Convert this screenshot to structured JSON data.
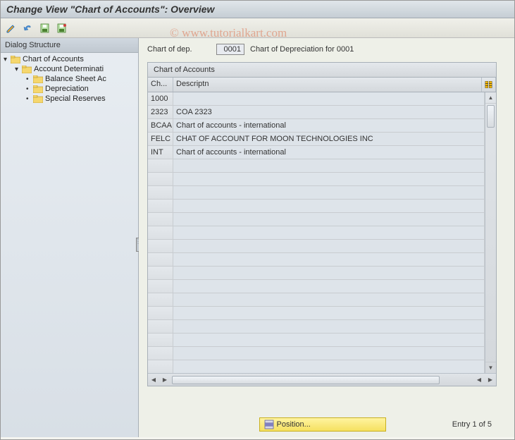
{
  "title": "Change View \"Chart of Accounts\": Overview",
  "watermark": "© www.tutorialkart.com",
  "sidebar": {
    "header": "Dialog Structure",
    "items": [
      {
        "label": "Chart of Accounts",
        "level": 0,
        "open": true
      },
      {
        "label": "Account Determinati",
        "level": 1,
        "open": true
      },
      {
        "label": "Balance Sheet Ac",
        "level": 2,
        "open": false
      },
      {
        "label": "Depreciation",
        "level": 2,
        "open": false
      },
      {
        "label": "Special Reserves",
        "level": 2,
        "open": false
      }
    ]
  },
  "field": {
    "label": "Chart of dep.",
    "value": "0001",
    "description": "Chart of Depreciation for 0001"
  },
  "table": {
    "title": "Chart of Accounts",
    "columns": {
      "code": "Ch...",
      "desc": "Descriptn"
    },
    "rows": [
      {
        "code": "1000",
        "desc": ""
      },
      {
        "code": "2323",
        "desc": "COA 2323"
      },
      {
        "code": "BCAA",
        "desc": "Chart of accounts - international"
      },
      {
        "code": "FELC",
        "desc": "CHAT OF ACCOUNT FOR MOON TECHNOLOGIES INC"
      },
      {
        "code": "INT",
        "desc": "Chart of accounts - international"
      },
      {
        "code": "",
        "desc": ""
      },
      {
        "code": "",
        "desc": ""
      },
      {
        "code": "",
        "desc": ""
      },
      {
        "code": "",
        "desc": ""
      },
      {
        "code": "",
        "desc": ""
      },
      {
        "code": "",
        "desc": ""
      },
      {
        "code": "",
        "desc": ""
      },
      {
        "code": "",
        "desc": ""
      },
      {
        "code": "",
        "desc": ""
      },
      {
        "code": "",
        "desc": ""
      },
      {
        "code": "",
        "desc": ""
      },
      {
        "code": "",
        "desc": ""
      },
      {
        "code": "",
        "desc": ""
      },
      {
        "code": "",
        "desc": ""
      },
      {
        "code": "",
        "desc": ""
      },
      {
        "code": "",
        "desc": ""
      }
    ]
  },
  "footer": {
    "position_button": "Position...",
    "entry_text": "Entry 1 of 5"
  }
}
